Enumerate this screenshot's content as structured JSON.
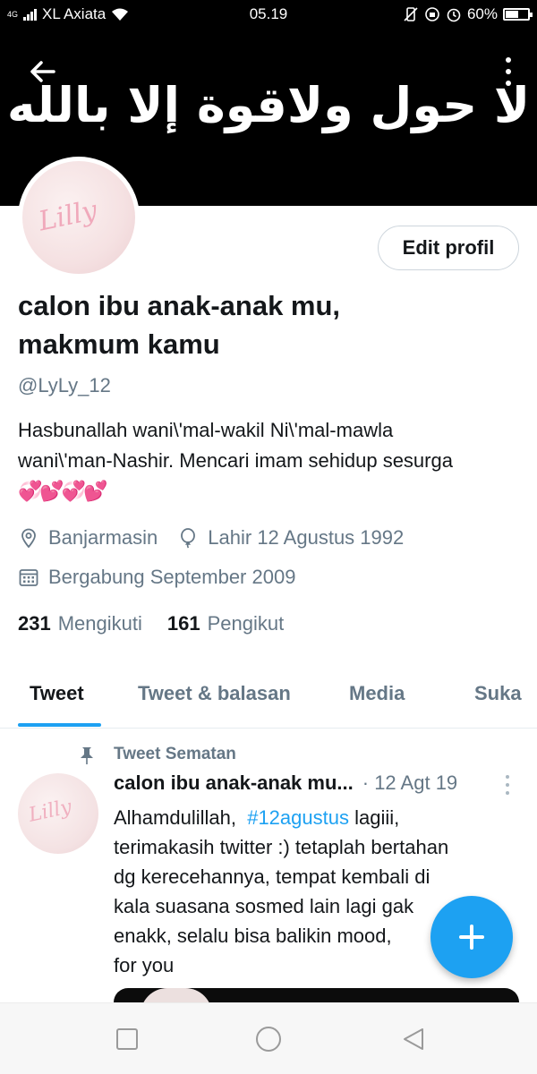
{
  "status_bar": {
    "network_type": "4G",
    "carrier": "XL Axiata",
    "time": "05.19",
    "battery": "60%",
    "battery_level": 0.6
  },
  "banner": {
    "text": "لا حول ولاقوة إلا بالله"
  },
  "avatar": {
    "text": "Lilly"
  },
  "profile": {
    "edit_button": "Edit profil",
    "display_name_line1": "calon ibu anak-anak mu,",
    "display_name_line2": "makmum kamu",
    "handle": "@LyLy_12",
    "bio_line1": "Hasbunallah wani\\'mal-wakil Ni\\'mal-mawla",
    "bio_line2": "wani\\'man-Nashir. Mencari imam sehidup sesurga",
    "bio_emoji": "💞💕💞💕",
    "location": "Banjarmasin",
    "birthday": "Lahir 12 Agustus 1992",
    "joined": "Bergabung September 2009",
    "following_count": "231",
    "following_label": "Mengikuti",
    "followers_count": "161",
    "followers_label": "Pengikut"
  },
  "tabs": [
    {
      "label": "Tweet",
      "active": true
    },
    {
      "label": "Tweet & balasan",
      "active": false
    },
    {
      "label": "Media",
      "active": false
    },
    {
      "label": "Suka",
      "active": false
    }
  ],
  "pinned_tweet": {
    "pinned_label": "Tweet Sematan",
    "author": "calon ibu anak-anak mu...",
    "date": "· 12 Agt 19",
    "body_pre": "Alhamdulillah,",
    "hashtag": "#12agustus",
    "body_post": " lagiii,",
    "line2": "terimakasih twitter :) tetaplah bertahan",
    "line3": "dg kerecehannya,  tempat kembali di",
    "line4": "kala suasana sosmed lain lagi gak",
    "line5": "enakk,  selalu bisa balikin mood,",
    "line6": "for you"
  },
  "colors": {
    "accent": "#1da1f2",
    "secondary_text": "#657786",
    "primary_text": "#14171a"
  }
}
